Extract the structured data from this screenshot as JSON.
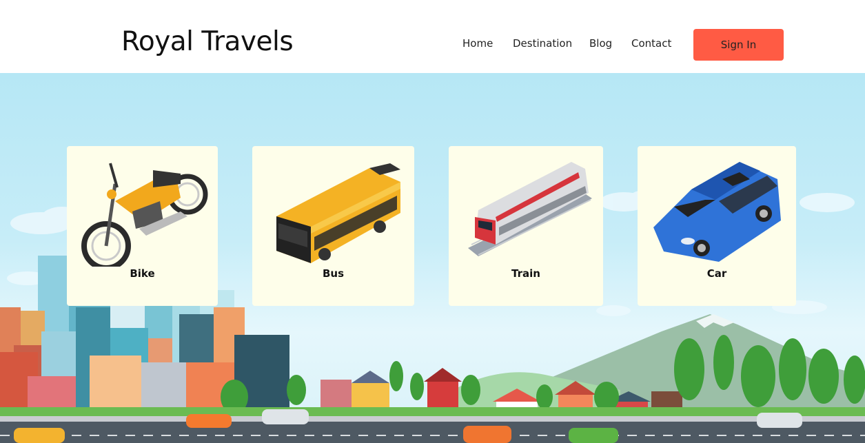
{
  "header": {
    "brand": "Royal Travels",
    "nav": [
      "Home",
      "Destination",
      "Blog",
      "Contact"
    ],
    "signin_label": "Sign In",
    "accent_color": "#ff5b44"
  },
  "vehicles": [
    {
      "label": "Bike",
      "icon": "motorbike-icon"
    },
    {
      "label": "Bus",
      "icon": "bus-icon"
    },
    {
      "label": "Train",
      "icon": "train-icon"
    },
    {
      "label": "Car",
      "icon": "car-icon"
    }
  ],
  "background": {
    "scene": "city-illustration",
    "sky_color": "#b6e7f5",
    "card_color": "#fefeea"
  }
}
